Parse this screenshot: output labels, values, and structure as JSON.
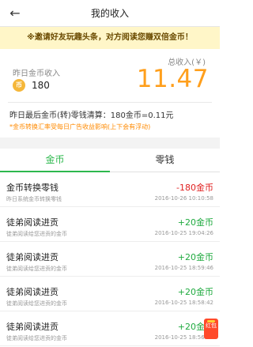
{
  "header": {
    "back_icon": "back-arrow-icon",
    "title": "我的收入"
  },
  "banner": {
    "text": "※邀请好友玩趣头条，对方阅读您赚双倍金币！"
  },
  "summary": {
    "coin_label": "昨日金币收入",
    "coin_icon": "coin-icon",
    "coin_icon_text": "币",
    "coin_value": "180",
    "income_label": "总收入(￥)",
    "income_value": "11.47",
    "rate_text": "昨日最后金币(转)零钱清算：180金币=0.11元",
    "rate_note": "*金币转换汇率受每日广告收益影响(上下会有浮动)"
  },
  "tabs": [
    {
      "label": "金币"
    },
    {
      "label": "零钱"
    }
  ],
  "records": [
    {
      "title": "金币转换零钱",
      "subtitle": "昨日系统金币转换零钱",
      "amount": "-180金币",
      "time": "2016-10-26 10:10:58"
    },
    {
      "title": "徒弟阅读进贡",
      "subtitle": "徒弟阅读给您进贡的金币",
      "amount": "+20金币",
      "time": "2016-10-25 19:04:26"
    },
    {
      "title": "徒弟阅读进贡",
      "subtitle": "徒弟阅读给您进贡的金币",
      "amount": "+20金币",
      "time": "2016-10-25 18:59:46"
    },
    {
      "title": "徒弟阅读进贡",
      "subtitle": "徒弟阅读给您进贡的金币",
      "amount": "+20金币",
      "time": "2016-10-25 18:58:42"
    },
    {
      "title": "徒弟阅读进贡",
      "subtitle": "徒弟阅读给您进贡的金币",
      "amount": "+20金币",
      "time": "2016-10-25 18:56:26"
    }
  ],
  "float_button": {
    "label": "红包",
    "icon": "red-envelope-icon"
  },
  "colors": {
    "accent_green": "#2db84d",
    "income_orange": "#ff9f1c",
    "negative_red": "#e02020",
    "positive_green": "#1faa3f"
  }
}
